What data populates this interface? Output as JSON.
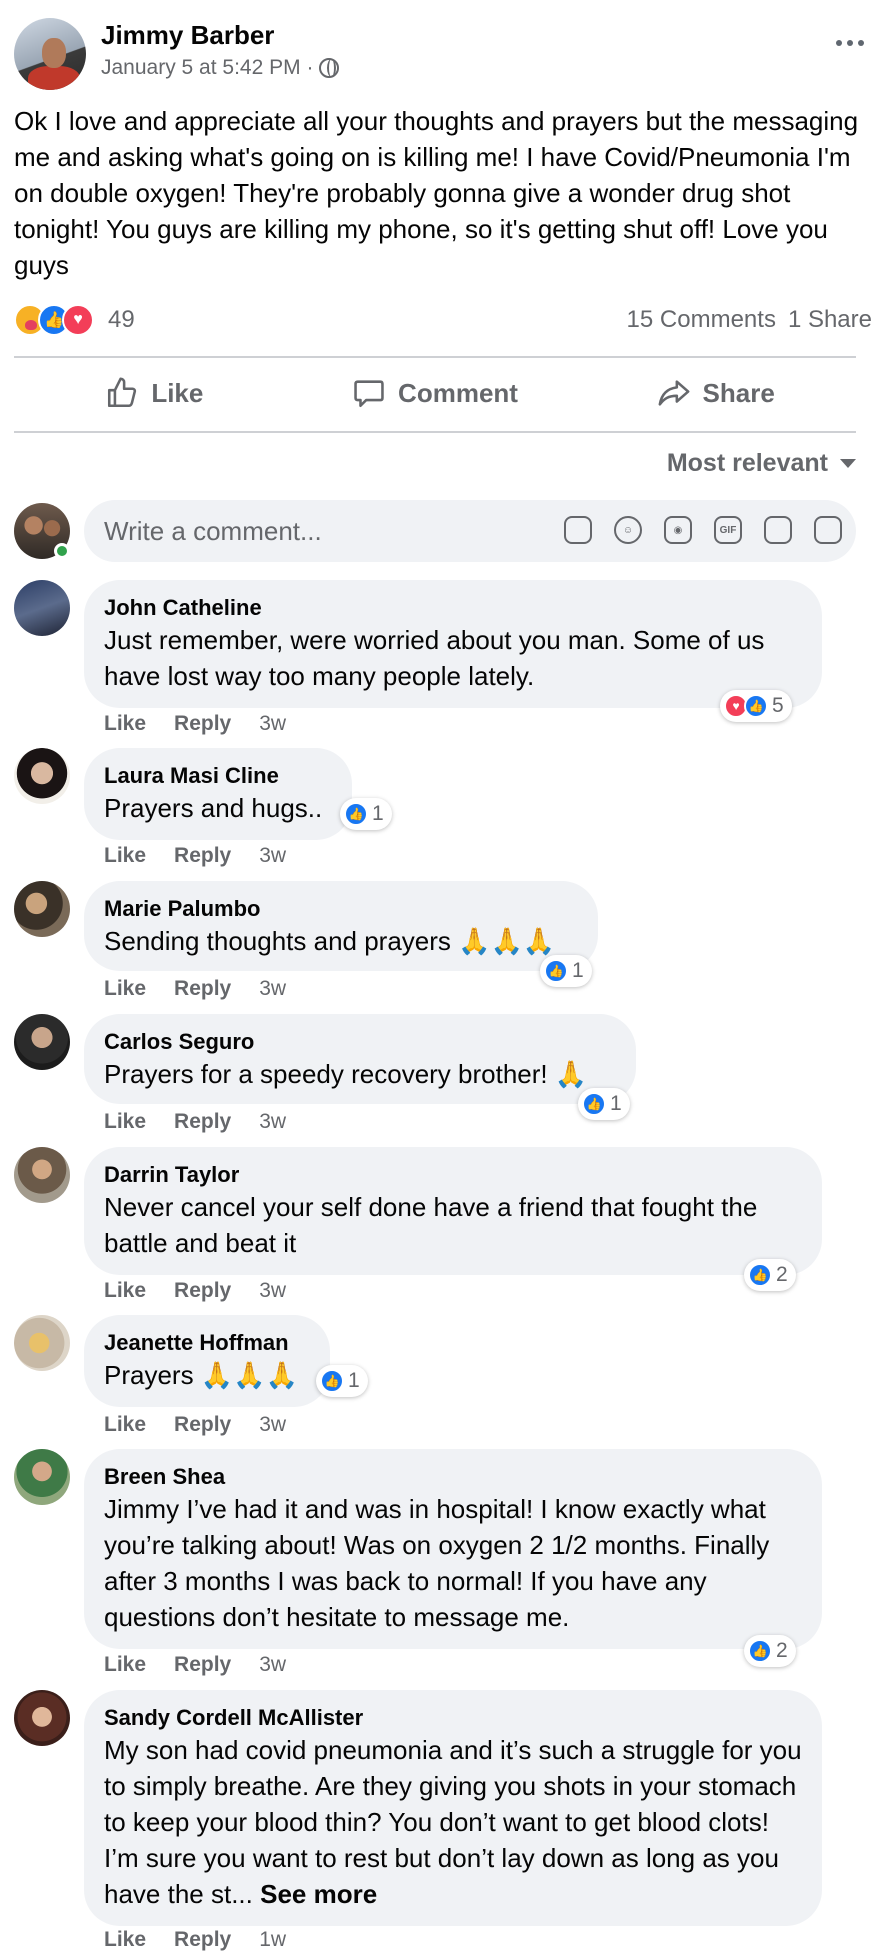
{
  "post": {
    "author": "Jimmy Barber",
    "timestamp": "January 5 at 5:42 PM ·",
    "privacy_icon": "globe-icon",
    "text": "Ok I love and appreciate all your thoughts and prayers but the messaging me and asking what's going on is killing me! I have Covid/Pneumonia I'm on double oxygen! They're probably gonna give a wonder drug shot tonight!  You guys are killing my phone, so it's getting shut off! Love you guys",
    "reaction_count": "49",
    "comments_count": "15 Comments",
    "shares_count": "1 Share"
  },
  "actions": {
    "like": "Like",
    "comment": "Comment",
    "share": "Share"
  },
  "sort_label": "Most relevant",
  "composer": {
    "placeholder": "Write a comment..."
  },
  "comment_actions": {
    "like": "Like",
    "reply": "Reply"
  },
  "comments": [
    {
      "name": "John Catheline",
      "text": "Just remember, were worried about you man. Some of us have lost way too many people lately.",
      "time": "3w",
      "reaction_count": "5"
    },
    {
      "name": "Laura Masi Cline",
      "text": "Prayers and hugs..",
      "time": "3w",
      "reaction_count": "1"
    },
    {
      "name": "Marie Palumbo",
      "text": "Sending thoughts and prayers",
      "emoji": "🙏🙏🙏",
      "time": "3w",
      "reaction_count": "1"
    },
    {
      "name": "Carlos Seguro",
      "text": "Prayers for a speedy recovery brother!",
      "emoji": "🙏",
      "time": "3w",
      "reaction_count": "1"
    },
    {
      "name": "Darrin Taylor",
      "text": "Never cancel your self done have a friend that fought the battle and beat it",
      "time": "3w",
      "reaction_count": "2"
    },
    {
      "name": "Jeanette Hoffman",
      "text": "Prayers",
      "emoji": "🙏🙏🙏",
      "time": "3w",
      "reaction_count": "1"
    },
    {
      "name": "Breen Shea",
      "text": "Jimmy I’ve had it and was in hospital! I know exactly what you’re talking about! Was on oxygen 2 1/2 months. Finally after 3 months I was back to normal! If you have any questions don’t hesitate to message me.",
      "time": "3w",
      "reaction_count": "2"
    },
    {
      "name": "Sandy Cordell McAllister",
      "text": "My son had covid pneumonia and it’s such a struggle for you to simply breathe. Are they giving you shots in your stomach to keep your blood thin? You don’t want to get blood clots! I’m sure you want to rest but don’t lay down as long as you have the st...",
      "see_more": "See more",
      "time": "1w"
    }
  ],
  "colors": {
    "accent": "#1877f2",
    "love": "#f33e58",
    "secondary_text": "#65676b",
    "bubble": "#f0f2f5"
  }
}
